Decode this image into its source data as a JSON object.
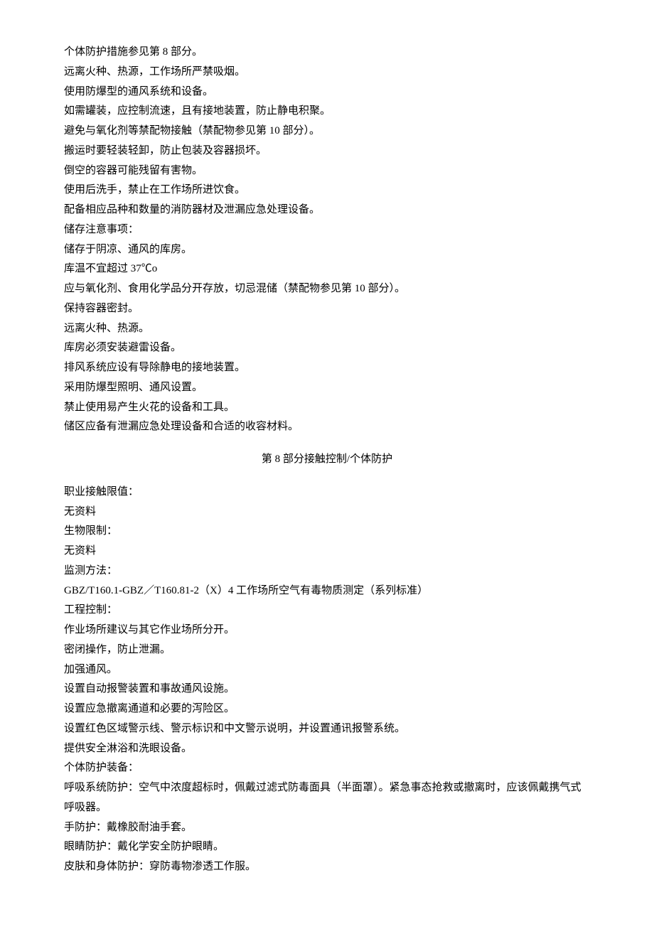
{
  "section7": {
    "lines": [
      "个体防护措施参见第 8 部分。",
      "远离火种、热源，工作场所严禁吸烟。",
      "使用防爆型的通风系统和设备。",
      "如需罐装，应控制流速，且有接地装置，防止静电积聚。",
      "避免与氧化剂等禁配物接触（禁配物参见第 10 部分）。",
      "搬运时要轻装轻卸，防止包装及容器损坏。",
      "倒空的容器可能残留有害物。",
      "使用后洗手，禁止在工作场所进饮食。",
      "配备相应品种和数量的消防器材及泄漏应急处理设备。",
      "储存注意事项：",
      "储存于阴凉、通风的库房。",
      "库温不宜超过 37℃o",
      "应与氧化剂、食用化学品分开存放，切忌混储（禁配物参见第 10 部分）。",
      "保持容器密封。",
      "远离火种、热源。",
      "库房必须安装避雷设备。",
      "排风系统应设有导除静电的接地装置。",
      "采用防爆型照明、通风设置。",
      "禁止使用易产生火花的设备和工具。",
      "储区应备有泄漏应急处理设备和合适的收容材料。"
    ]
  },
  "section8": {
    "title": "第 8 部分接触控制/个体防护",
    "lines": [
      "职业接触限值：",
      "无资料",
      "生物限制：",
      "无资料",
      "监测方法：",
      "GBZ/T160.1-GBZ／T160.81-2（X）4 工作场所空气有毒物质测定（系列标准）",
      "工程控制：",
      "作业场所建议与其它作业场所分开。",
      "密闭操作，防止泄漏。",
      "加强通风。",
      "设置自动报警装置和事故通风设施。",
      "设置应急撤离通道和必要的泻险区。",
      "设置红色区域警示线、警示标识和中文警示说明，并设置通讯报警系统。",
      "提供安全淋浴和洗眼设备。",
      "个体防护装备：",
      "呼吸系统防护：空气中浓度超标时，佩戴过滤式防毒面具（半面罩）。紧急事态抢救或撤离时，应该佩戴携气式呼吸器。",
      "手防护：戴橡胶耐油手套。",
      "眼睛防护：戴化学安全防护眼睛。",
      "皮肤和身体防护：穿防毒物渗透工作服。"
    ]
  }
}
